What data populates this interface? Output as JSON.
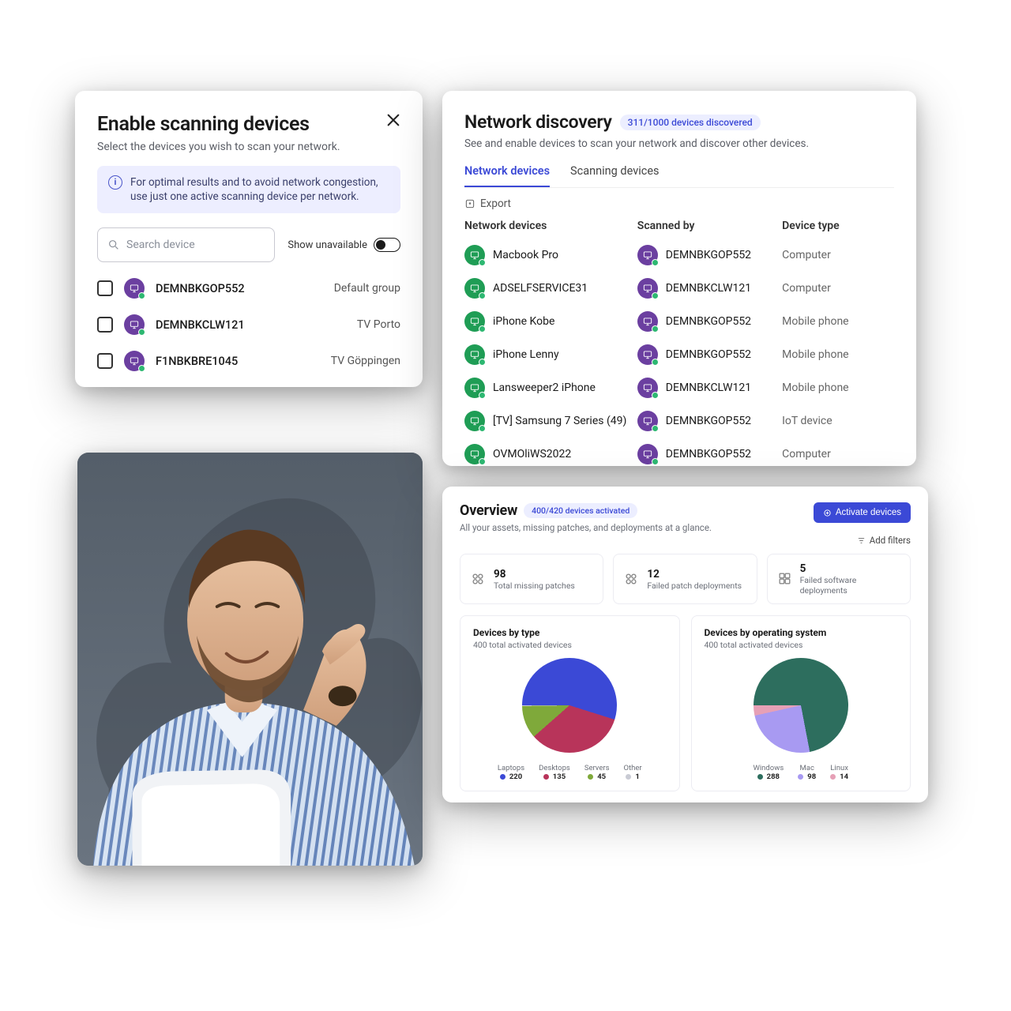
{
  "scanning": {
    "title": "Enable scanning devices",
    "subtitle": "Select the devices you wish to scan your network.",
    "info": "For optimal results and to avoid network congestion, use just one active scanning device per network.",
    "search_placeholder": "Search device",
    "toggle_label": "Show unavailable",
    "devices": [
      {
        "name": "DEMNBKGOP552",
        "group": "Default group"
      },
      {
        "name": "DEMNBKCLW121",
        "group": "TV Porto"
      },
      {
        "name": "F1NBKBRE1045",
        "group": "TV Göppingen"
      }
    ]
  },
  "discovery": {
    "title": "Network discovery",
    "pill": "311/1000 devices discovered",
    "subtitle": "See and enable devices to scan your network and discover other devices.",
    "tabs": [
      "Network devices",
      "Scanning devices"
    ],
    "export_label": "Export",
    "columns": [
      "Network devices",
      "Scanned by",
      "Device type"
    ],
    "rows": [
      {
        "device": "Macbook Pro",
        "scanned_by": "DEMNBKGOP552",
        "type": "Computer"
      },
      {
        "device": "ADSELFSERVICE31",
        "scanned_by": "DEMNBKCLW121",
        "type": "Computer"
      },
      {
        "device": "iPhone Kobe",
        "scanned_by": "DEMNBKGOP552",
        "type": "Mobile phone"
      },
      {
        "device": "iPhone Lenny",
        "scanned_by": "DEMNBKGOP552",
        "type": "Mobile phone"
      },
      {
        "device": "Lansweeper2 iPhone",
        "scanned_by": "DEMNBKCLW121",
        "type": "Mobile phone"
      },
      {
        "device": "[TV] Samsung 7 Series (49)",
        "scanned_by": "DEMNBKGOP552",
        "type": "IoT device"
      },
      {
        "device": "OVMOliWS2022",
        "scanned_by": "DEMNBKGOP552",
        "type": "Computer"
      }
    ]
  },
  "overview": {
    "title": "Overview",
    "pill": "400/420 devices activated",
    "subtitle": "All your assets, missing patches, and deployments at a glance.",
    "activate_label": "Activate devices",
    "filters_label": "Add filters",
    "stats": [
      {
        "value": "98",
        "label": "Total missing patches"
      },
      {
        "value": "12",
        "label": "Failed patch deployments"
      },
      {
        "value": "5",
        "label": "Failed software deployments"
      }
    ],
    "charts": {
      "by_type": {
        "title": "Devices by type",
        "subtitle": "400 total activated devices",
        "items": [
          {
            "label": "Laptops",
            "value": 220
          },
          {
            "label": "Desktops",
            "value": 135
          },
          {
            "label": "Servers",
            "value": 45
          },
          {
            "label": "Other",
            "value": 1
          }
        ],
        "colors": [
          "#3b49d6",
          "#b8345a",
          "#7fa93a",
          "#c9cbd4"
        ]
      },
      "by_os": {
        "title": "Devices by operating system",
        "subtitle": "400 total activated devices",
        "items": [
          {
            "label": "Windows",
            "value": 288
          },
          {
            "label": "Mac",
            "value": 98
          },
          {
            "label": "Linux",
            "value": 14
          }
        ],
        "colors": [
          "#2d6e5e",
          "#a89af2",
          "#e6a0b6"
        ]
      }
    }
  },
  "chart_data": [
    {
      "type": "pie",
      "title": "Devices by type",
      "subtitle": "400 total activated devices",
      "categories": [
        "Laptops",
        "Desktops",
        "Servers",
        "Other"
      ],
      "values": [
        220,
        135,
        45,
        1
      ],
      "colors": [
        "#3b49d6",
        "#b8345a",
        "#7fa93a",
        "#c9cbd4"
      ]
    },
    {
      "type": "pie",
      "title": "Devices by operating system",
      "subtitle": "400 total activated devices",
      "categories": [
        "Windows",
        "Mac",
        "Linux"
      ],
      "values": [
        288,
        98,
        14
      ],
      "colors": [
        "#2d6e5e",
        "#a89af2",
        "#e6a0b6"
      ]
    }
  ]
}
